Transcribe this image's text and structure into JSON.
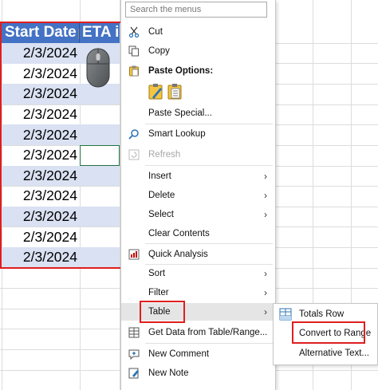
{
  "columns": {
    "start_date_header": "Start Date",
    "eta_header": "ETA in"
  },
  "rows": [
    "2/3/2024",
    "2/3/2024",
    "2/3/2024",
    "2/3/2024",
    "2/3/2024",
    "2/3/2024",
    "2/3/2024",
    "2/3/2024",
    "2/3/2024",
    "2/3/2024",
    "2/3/2024"
  ],
  "menu": {
    "search_placeholder": "Search the menus",
    "cut": "Cut",
    "copy": "Copy",
    "paste_options": "Paste Options:",
    "paste_special": "Paste Special...",
    "smart_lookup": "Smart Lookup",
    "refresh": "Refresh",
    "insert": "Insert",
    "delete": "Delete",
    "select": "Select",
    "clear_contents": "Clear Contents",
    "quick_analysis": "Quick Analysis",
    "sort": "Sort",
    "filter": "Filter",
    "table": "Table",
    "get_data": "Get Data from Table/Range...",
    "new_comment": "New Comment",
    "new_note": "New Note"
  },
  "submenu": {
    "totals_row": "Totals Row",
    "convert_to_range": "Convert to Range",
    "alternative_text": "Alternative Text..."
  },
  "colors": {
    "header_blue": "#4472c4",
    "band_blue": "#d9e1f2",
    "highlight_red": "#e01e1e",
    "selection_green": "#217346"
  },
  "icons": [
    "scissors-icon",
    "copy-icon",
    "paste-icon",
    "paste-values-icon",
    "smart-lookup-icon",
    "refresh-icon",
    "quick-analysis-icon",
    "table-icon",
    "new-comment-icon",
    "new-note-icon",
    "totals-row-icon",
    "mouse-icon"
  ]
}
